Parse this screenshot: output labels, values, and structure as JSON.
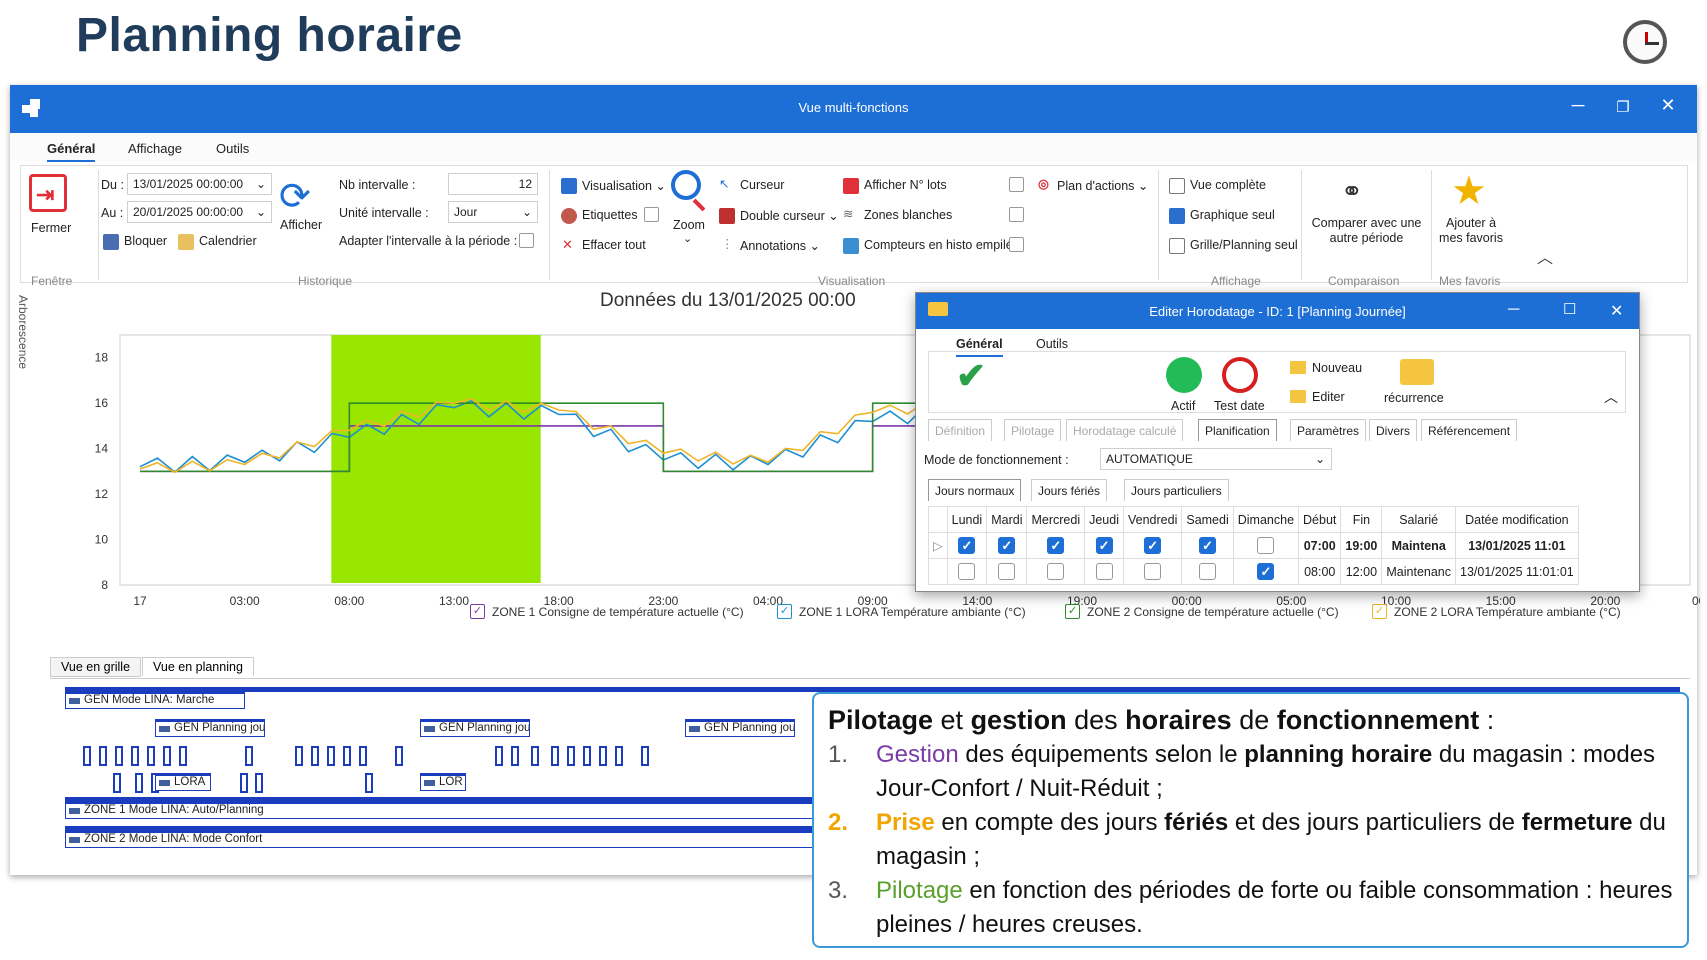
{
  "slide": {
    "title": "Planning horaire"
  },
  "window": {
    "title": "Vue multi-fonctions"
  },
  "menu": [
    "Général",
    "Affichage",
    "Outils"
  ],
  "ribbon": {
    "fermer": "Fermer",
    "fenetre": "Fenêtre",
    "du_label": "Du :",
    "du_value": "13/01/2025 00:00:00",
    "au_label": "Au :",
    "au_value": "20/01/2025 00:00:00",
    "bloquer": "Bloquer",
    "calendrier": "Calendrier",
    "afficher": "Afficher",
    "nb_intervalle_label": "Nb intervalle :",
    "nb_intervalle_value": "12",
    "unite_label": "Unité intervalle :",
    "unite_value": "Jour",
    "adapter_label": "Adapter l'intervalle à la période :",
    "historique": "Historique",
    "visualisation_btn": "Visualisation",
    "etiquettes": "Etiquettes",
    "effacer": "Effacer tout",
    "zoom": "Zoom",
    "curseur": "Curseur",
    "double_curseur": "Double curseur",
    "annotations": "Annotations",
    "afficher_lots": "Afficher N° lots",
    "zones_blanches": "Zones blanches",
    "compteurs": "Compteurs en histo empilé",
    "plan_actions": "Plan d'actions",
    "visualisation": "Visualisation",
    "vue_complete": "Vue complète",
    "graphique_seul": "Graphique seul",
    "grille_planning": "Grille/Planning seul",
    "affichage": "Affichage",
    "comparer": "Comparer avec une autre période",
    "comparaison": "Comparaison",
    "ajouter": "Ajouter à mes favoris",
    "mes_favoris": "Mes favoris"
  },
  "chart": {
    "side_tab": "Arborescence",
    "title": "Données du 13/01/2025 00:00",
    "y_ticks": [
      "18",
      "16",
      "14",
      "12",
      "10",
      "8"
    ],
    "x_ticks": [
      "17",
      "03:00",
      "08:00",
      "13:00",
      "18:00",
      "23:00",
      "04:00",
      "09:00",
      "14:00",
      "19:00",
      "00:00",
      "05:00",
      "10:00",
      "15:00",
      "20:00"
    ],
    "x_tail": "00",
    "legend": [
      {
        "label": "ZONE 1 Consigne de température actuelle (°C)",
        "color": "#7a3aa8"
      },
      {
        "label": "ZONE 1 LORA Température ambiante (°C)",
        "color": "#1e8fd0"
      },
      {
        "label": "ZONE 2 Consigne de température actuelle (°C)",
        "color": "#2e8b2e"
      },
      {
        "label": "ZONE 2 LORA Température ambiante (°C)",
        "color": "#f0b428"
      }
    ]
  },
  "chart_data": {
    "type": "line",
    "y_range": [
      8,
      19
    ],
    "x_labels": [
      "17",
      "03:00",
      "08:00",
      "13:00",
      "18:00",
      "23:00",
      "04:00",
      "09:00",
      "14:00",
      "19:00",
      "00:00",
      "05:00",
      "10:00",
      "15:00",
      "20:00"
    ],
    "highlight": {
      "from_index": 2,
      "to_index": 4,
      "color": "#99e600"
    },
    "series": [
      {
        "name": "ZONE 1 Consigne de température actuelle (°C)",
        "color": "#7a3aa8",
        "values": [
          13,
          13,
          15,
          15,
          15,
          13,
          13,
          15,
          15,
          15,
          13,
          13,
          15,
          15,
          15
        ]
      },
      {
        "name": "ZONE 1 LORA Température ambiante (°C)",
        "color": "#1e8fd0",
        "values": [
          13.2,
          13.4,
          14.5,
          15.8,
          15.5,
          13.5,
          13.3,
          15.2,
          15.8,
          14.6,
          13.3,
          13.4,
          16.1,
          15.4,
          14.2
        ]
      },
      {
        "name": "ZONE 2 Consigne de température actuelle (°C)",
        "color": "#2e8b2e",
        "values": [
          13,
          13,
          16,
          16,
          16,
          13,
          13,
          16,
          16,
          16,
          13,
          13,
          16,
          16,
          16
        ]
      },
      {
        "name": "ZONE 2 LORA Température ambiante (°C)",
        "color": "#f0b428",
        "values": [
          13.1,
          13.3,
          14.8,
          16.0,
          15.7,
          13.8,
          13.4,
          15.6,
          16.0,
          15.0,
          13.5,
          13.6,
          16.3,
          15.8,
          14.8
        ]
      }
    ]
  },
  "bottom_tabs": [
    "Vue en grille",
    "Vue en planning"
  ],
  "planning": {
    "gen_mode": "GEN Mode LINA: Marche",
    "gen_planning": "GEN Planning jou",
    "lora": "LORA",
    "lor": "LOR",
    "zone1": "ZONE 1 Mode LINA: Auto/Planning",
    "zone2": "ZONE 2 Mode LINA: Mode Confort"
  },
  "dialog": {
    "title": "Editer Horodatage - ID: 1  [Planning Journée]",
    "tabs": [
      "Général",
      "Outils"
    ],
    "actif": "Actif",
    "test_date": "Test date",
    "nouveau": "Nouveau",
    "editer": "Editer",
    "recurrence": "récurrence",
    "subtabs": [
      "Définition",
      "Pilotage",
      "Horodatage calculé",
      "Planification",
      "Paramètres",
      "Divers",
      "Référencement"
    ],
    "mode_label": "Mode de fonctionnement :",
    "mode_value": "AUTOMATIQUE",
    "day_tabs": [
      "Jours normaux",
      "Jours fériés",
      "Jours particuliers"
    ],
    "columns": [
      "Lundi",
      "Mardi",
      "Mercredi",
      "Jeudi",
      "Vendredi",
      "Samedi",
      "Dimanche",
      "Début",
      "Fin",
      "Salarié",
      "Datée modification"
    ],
    "rows": [
      {
        "days": [
          true,
          true,
          true,
          true,
          true,
          true,
          false
        ],
        "debut": "07:00",
        "fin": "19:00",
        "salarie": "Maintena",
        "date": "13/01/2025 11:01"
      },
      {
        "days": [
          false,
          false,
          false,
          false,
          false,
          false,
          true
        ],
        "debut": "08:00",
        "fin": "12:00",
        "salarie": "Maintenanc",
        "date": "13/01/2025 11:01:01"
      }
    ]
  },
  "info": {
    "head_parts": [
      "Pilotage",
      " et ",
      "gestion",
      " des ",
      "horaires",
      " de ",
      "fonctionnement",
      " :"
    ],
    "items": [
      {
        "num": "1.",
        "num_color": "#7a3aa8",
        "parts": [
          "Gestion",
          " des équipements selon le ",
          "planning horaire",
          " du magasin : modes Jour-Confort / Nuit-Réduit ;"
        ]
      },
      {
        "num": "2.",
        "num_color": "#f0a500",
        "parts": [
          "Prise",
          " en compte des jours ",
          "fériés",
          " et des jours particuliers de ",
          "fermeture",
          " du magasin ;"
        ]
      },
      {
        "num": "3.",
        "num_color": "#5aa02c",
        "parts": [
          "Pilotage",
          " en fonction des périodes de forte ou faible consommation : heures pleines / heures creuses."
        ]
      }
    ]
  }
}
